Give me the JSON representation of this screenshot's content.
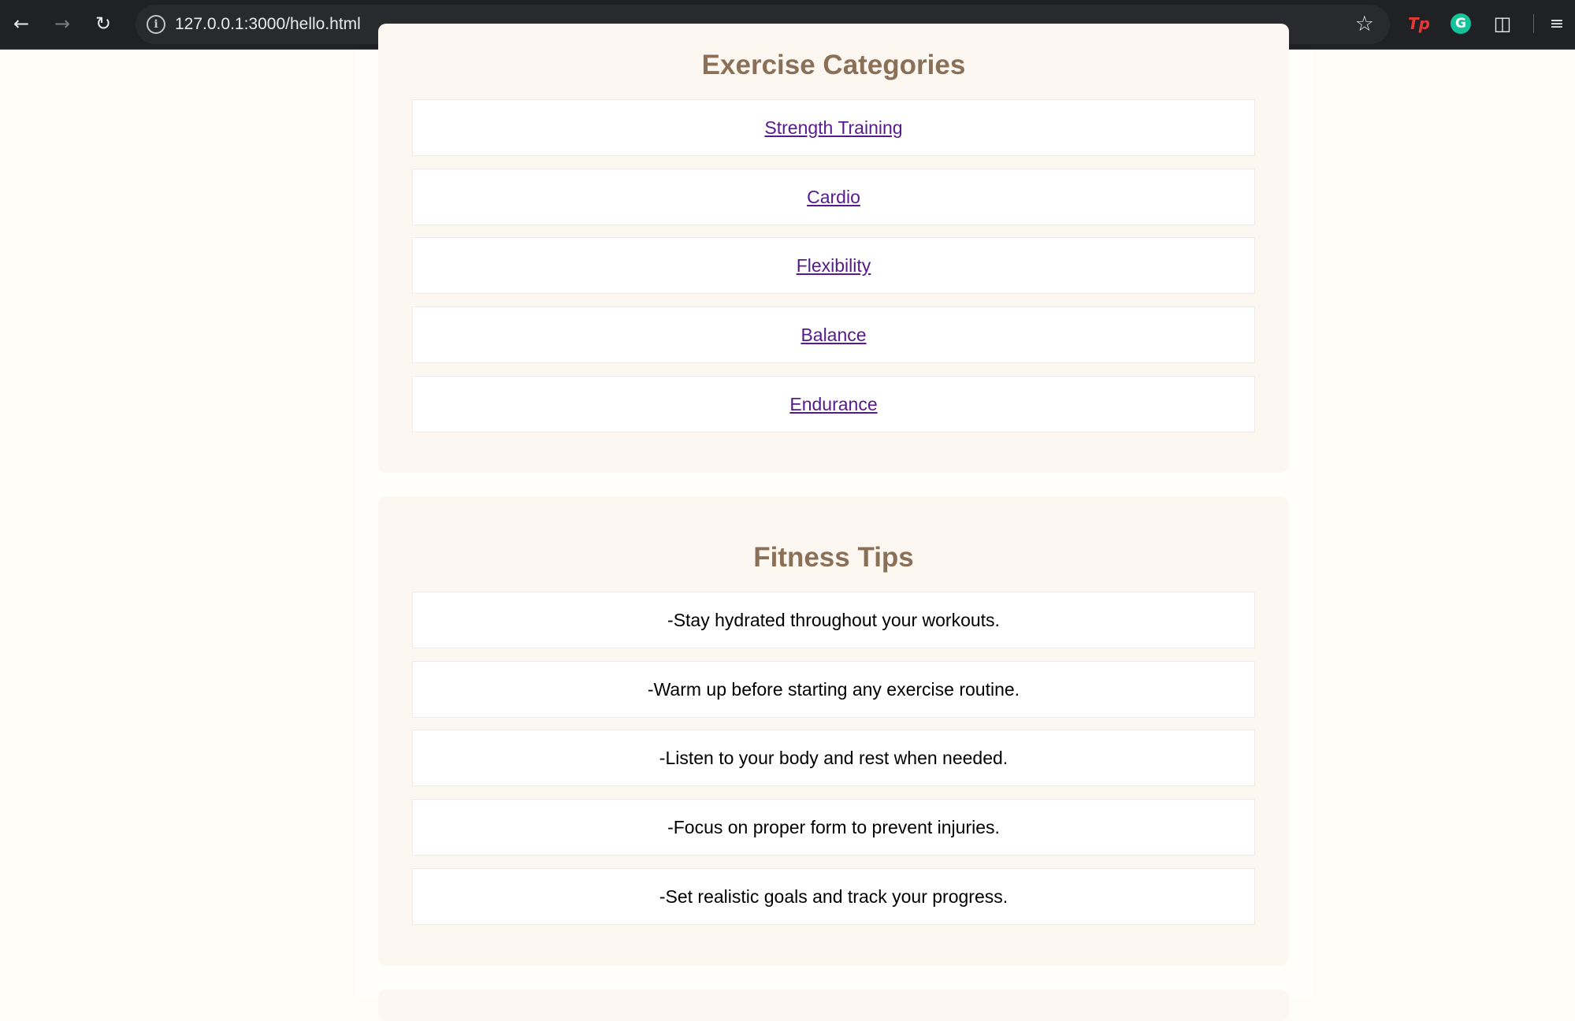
{
  "browser": {
    "url": "127.0.0.1:3000/hello.html",
    "back_icon": "back-arrow-icon",
    "forward_icon": "forward-arrow-icon",
    "reload_icon": "reload-icon",
    "site_info_icon": "info-icon",
    "bookmark_icon": "star-icon",
    "extensions": {
      "tp_label": "Tp",
      "grammarly_label": "G",
      "puzzle_icon": "puzzle-icon",
      "media_icon": "media-queue-icon"
    }
  },
  "categories": {
    "title": "Exercise Categories",
    "items": [
      {
        "label": "Strength Training"
      },
      {
        "label": "Cardio"
      },
      {
        "label": "Flexibility"
      },
      {
        "label": "Balance"
      },
      {
        "label": "Endurance"
      }
    ]
  },
  "tips": {
    "title": "Fitness Tips",
    "items": [
      {
        "text": "-Stay hydrated throughout your workouts."
      },
      {
        "text": "-Warm up before starting any exercise routine."
      },
      {
        "text": "-Listen to your body and rest when needed."
      },
      {
        "text": "-Focus on proper form to prevent injuries."
      },
      {
        "text": "-Set realistic goals and track your progress."
      }
    ]
  },
  "colors": {
    "page_background": "#fdfcf7",
    "section_background": "#fdf7f2",
    "heading": "#8b7058",
    "link_visited": "#551a8b",
    "browser_toolbar": "#202124"
  }
}
